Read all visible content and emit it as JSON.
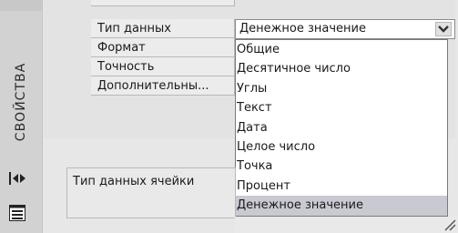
{
  "panel": {
    "title": "СВОЙСТВА"
  },
  "properties": [
    {
      "label": "Тип данных"
    },
    {
      "label": "Формат"
    },
    {
      "label": "Точность"
    },
    {
      "label": "Дополнительны..."
    }
  ],
  "data_type_select": {
    "value": "Денежное значение",
    "options": [
      "Общие",
      "Десятичное число",
      "Углы",
      "Текст",
      "Дата",
      "Целое число",
      "Точка",
      "Процент",
      "Денежное значение"
    ],
    "selected_index": 8
  },
  "description": {
    "text": "Тип данных ячейки"
  },
  "colors": {
    "selected_option_bg": "#c9c9d2",
    "panel_bg": "#e7e7e7"
  },
  "icons": [
    "expand-collapse-icon",
    "properties-list-icon",
    "dropdown-arrow-icon",
    "resize-grip-icon"
  ]
}
